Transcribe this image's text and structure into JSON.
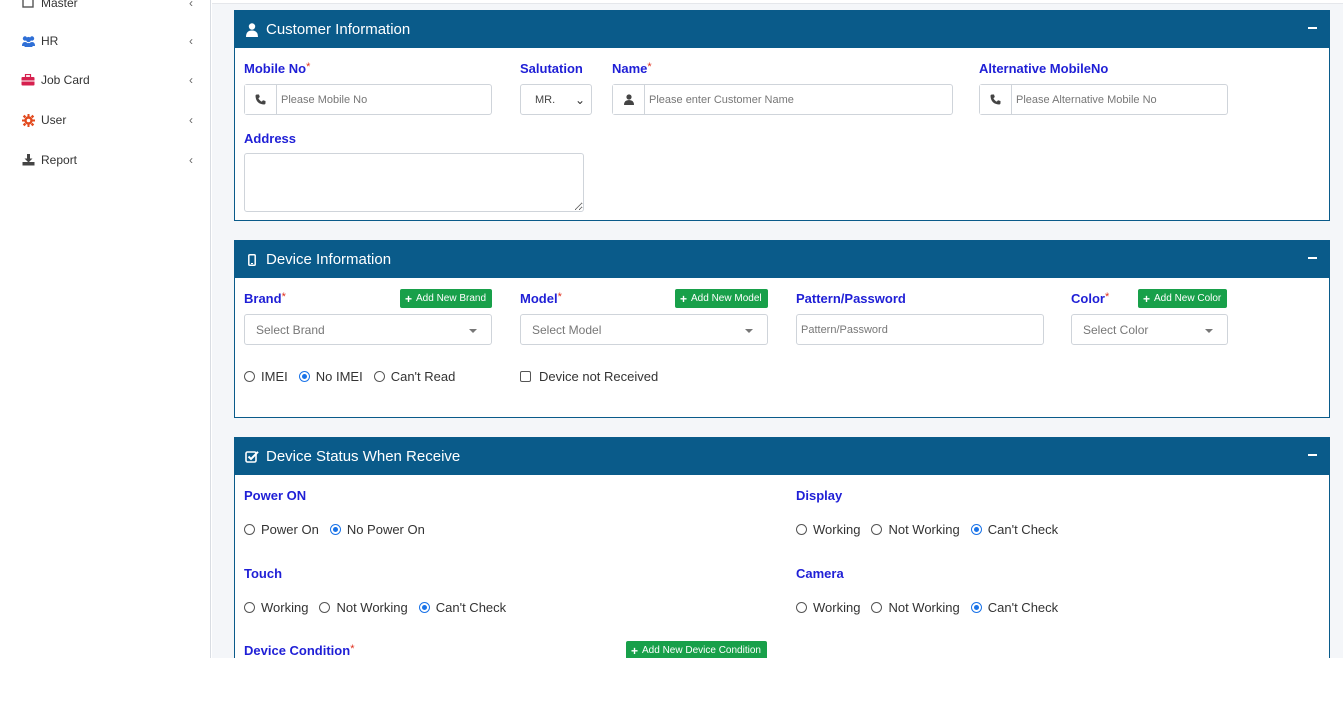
{
  "sidebar": {
    "items": [
      {
        "label": "Master",
        "icon": "master-icon"
      },
      {
        "label": "HR",
        "icon": "users-icon"
      },
      {
        "label": "Job Card",
        "icon": "briefcase-icon"
      },
      {
        "label": "User",
        "icon": "gear-icon"
      },
      {
        "label": "Report",
        "icon": "download-icon"
      }
    ]
  },
  "customer": {
    "title": "Customer Information",
    "mobile_label": "Mobile No",
    "mobile_placeholder": "Please Mobile No",
    "salutation_label": "Salutation",
    "salutation_value": "MR.",
    "name_label": "Name",
    "name_placeholder": "Please enter Customer Name",
    "alt_mobile_label": "Alternative MobileNo",
    "alt_mobile_placeholder": "Please Alternative Mobile No",
    "address_label": "Address",
    "required_mark": "*"
  },
  "device": {
    "title": "Device Information",
    "brand_label": "Brand",
    "add_brand": "Add New Brand",
    "brand_select": "Select Brand",
    "model_label": "Model",
    "add_model": "Add New Model",
    "model_select": "Select Model",
    "pattern_label": "Pattern/Password",
    "pattern_placeholder": "Pattern/Password",
    "color_label": "Color",
    "add_color": "Add New Color",
    "color_select": "Select Color",
    "imei_options": [
      "IMEI",
      "No IMEI",
      "Can't Read"
    ],
    "imei_selected": "No IMEI",
    "not_received_label": "Device not Received"
  },
  "status": {
    "title": "Device Status When Receive",
    "power_label": "Power ON",
    "power_options": [
      "Power On",
      "No Power On"
    ],
    "power_selected": "No Power On",
    "display_label": "Display",
    "display_options": [
      "Working",
      "Not Working",
      "Can't Check"
    ],
    "display_selected": "Can't Check",
    "touch_label": "Touch",
    "touch_options": [
      "Working",
      "Not Working",
      "Can't Check"
    ],
    "touch_selected": "Can't Check",
    "camera_label": "Camera",
    "camera_options": [
      "Working",
      "Not Working",
      "Can't Check"
    ],
    "camera_selected": "Can't Check",
    "condition_label": "Device Condition",
    "add_condition": "Add New Device Condition"
  },
  "colors": {
    "header": "#0a5b8a",
    "label": "#1f1fd6",
    "required": "#e0301e",
    "add_button": "#18a04a",
    "radio_checked": "#1a73e8"
  }
}
